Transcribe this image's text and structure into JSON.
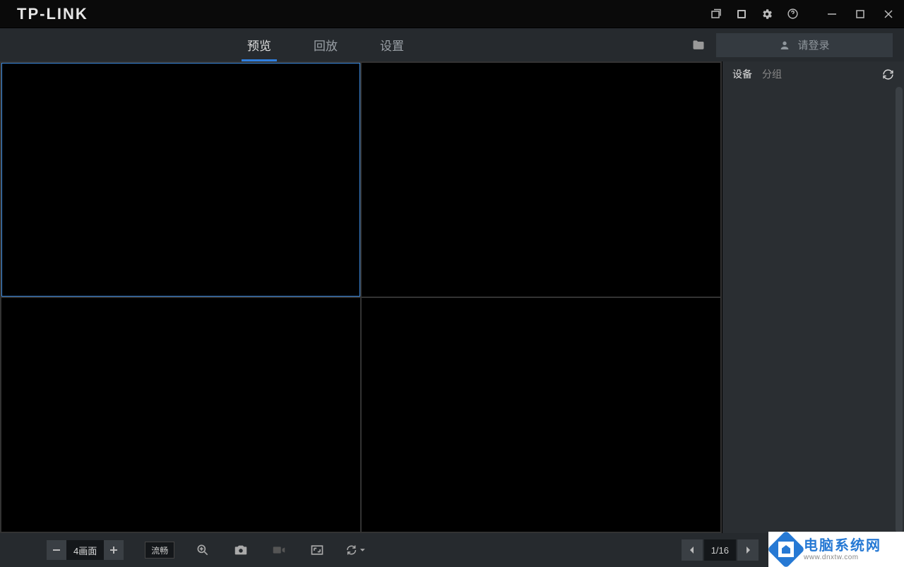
{
  "brand": "TP-LINK",
  "nav": {
    "tabs": [
      {
        "label": "预览",
        "active": true
      },
      {
        "label": "回放",
        "active": false
      },
      {
        "label": "设置",
        "active": false
      }
    ],
    "login_label": "请登录"
  },
  "sidebar": {
    "tabs": [
      {
        "label": "设备",
        "active": true
      },
      {
        "label": "分组",
        "active": false
      }
    ]
  },
  "toolbar": {
    "split_label": "4画面",
    "stream_label": "流畅",
    "pager_label": "1/16"
  },
  "watermark": {
    "cn": "电脑系统网",
    "en": "www.dnxtw.com"
  },
  "colors": {
    "accent": "#2f7fe0",
    "bg_dark": "#262a2e",
    "bg_black": "#000000"
  }
}
